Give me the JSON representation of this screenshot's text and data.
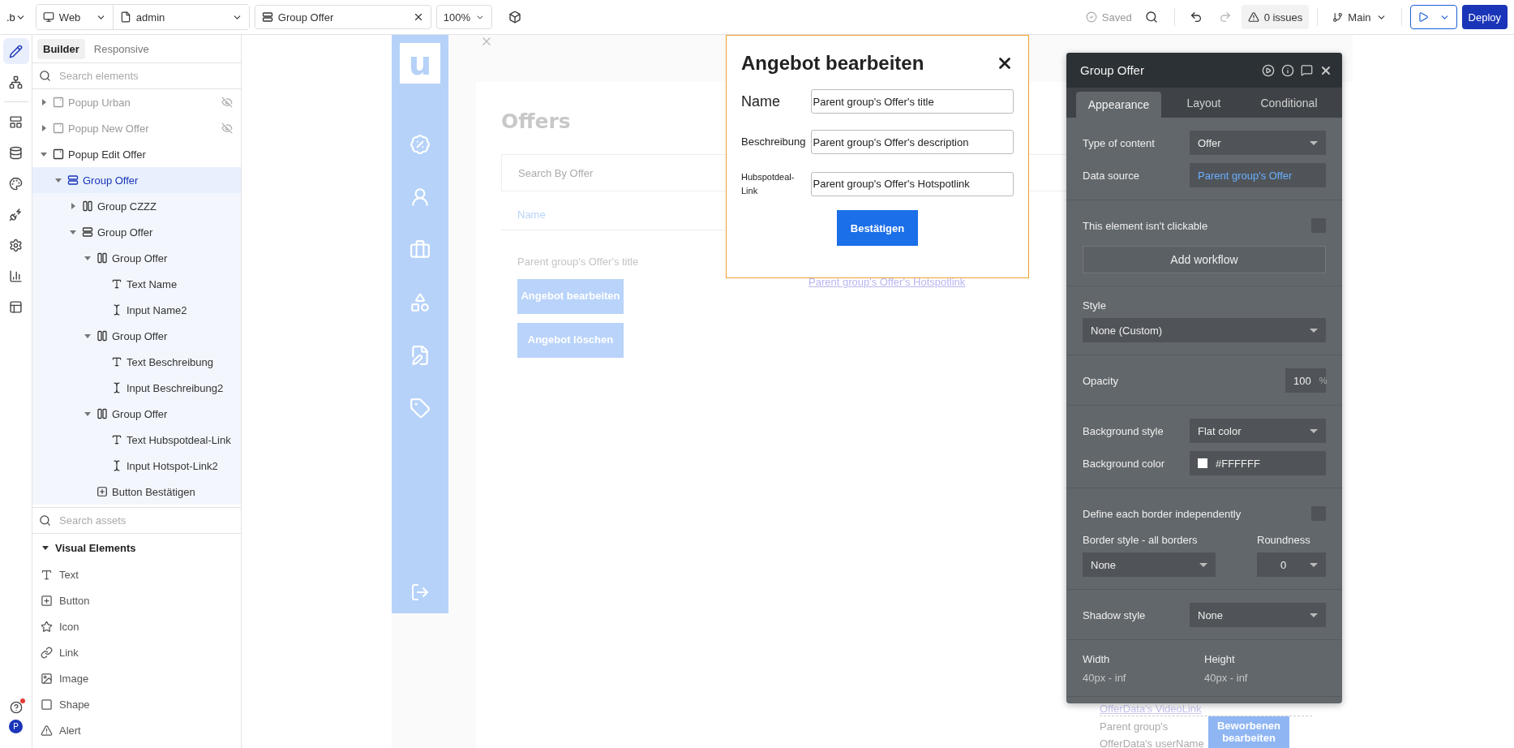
{
  "topbar": {
    "logo": ".b",
    "platform": "Web",
    "page": "admin",
    "element": "Group Offer",
    "zoom": "100%",
    "saved": "Saved",
    "issues": "0 issues",
    "branch": "Main",
    "deploy": "Deploy"
  },
  "rail": {
    "primary": [
      {
        "kind": "design",
        "selected": true
      },
      {
        "kind": "tree",
        "selected": false
      }
    ],
    "secondary": [
      {
        "kind": "styles",
        "selected": false
      },
      {
        "kind": "data",
        "selected": false
      },
      {
        "kind": "palette",
        "selected": false
      },
      {
        "kind": "plugins",
        "selected": false
      },
      {
        "kind": "settings",
        "selected": false
      },
      {
        "kind": "logs",
        "selected": false
      },
      {
        "kind": "templates",
        "selected": false
      }
    ],
    "help": {
      "notification": true
    },
    "avatar": "P"
  },
  "builder_tabs": [
    {
      "label": "Builder",
      "selected": true
    },
    {
      "label": "Responsive",
      "selected": false
    }
  ],
  "element_search": {
    "placeholder": "Search elements"
  },
  "tree": [
    {
      "label": "Popup Urban",
      "kind": "popup",
      "hidden": true,
      "expanded": false,
      "selected": false
    },
    {
      "label": "Popup New Offer",
      "kind": "popup",
      "hidden": true,
      "expanded": false,
      "selected": false
    },
    {
      "label": "Popup Edit Offer",
      "kind": "popup",
      "hidden": false,
      "expanded": true,
      "selected": false,
      "children": [
        {
          "label": "Group Offer",
          "kind": "rows",
          "hidden": false,
          "expanded": true,
          "selected": true,
          "children": [
            {
              "label": "Group CZZZ",
              "kind": "columns",
              "hidden": false,
              "expanded": false,
              "selected": false
            },
            {
              "label": "Group Offer",
              "kind": "rows",
              "hidden": false,
              "expanded": true,
              "selected": false,
              "children": [
                {
                  "label": "Group Offer",
                  "kind": "columns",
                  "hidden": false,
                  "expanded": true,
                  "selected": false,
                  "children": [
                    {
                      "label": "Text Name",
                      "kind": "text",
                      "hidden": false,
                      "selected": false
                    },
                    {
                      "label": "Input Name2",
                      "kind": "input",
                      "hidden": false,
                      "selected": false
                    }
                  ]
                },
                {
                  "label": "Group Offer",
                  "kind": "columns",
                  "hidden": false,
                  "expanded": true,
                  "selected": false,
                  "children": [
                    {
                      "label": "Text Beschreibung",
                      "kind": "text",
                      "hidden": false,
                      "selected": false
                    },
                    {
                      "label": "Input Beschreibung2",
                      "kind": "input",
                      "hidden": false,
                      "selected": false
                    }
                  ]
                },
                {
                  "label": "Group Offer",
                  "kind": "columns",
                  "hidden": false,
                  "expanded": true,
                  "selected": false,
                  "children": [
                    {
                      "label": "Text Hubspotdeal-Link",
                      "kind": "text",
                      "hidden": false,
                      "selected": false
                    },
                    {
                      "label": "Input Hotspot-Link2",
                      "kind": "input",
                      "hidden": false,
                      "selected": false
                    }
                  ]
                },
                {
                  "label": "Button Bestätigen",
                  "kind": "button",
                  "hidden": false,
                  "selected": false
                }
              ]
            }
          ]
        }
      ]
    }
  ],
  "asset_search": {
    "placeholder": "Search assets"
  },
  "assets": {
    "title": "Visual Elements",
    "expanded": true,
    "items": [
      {
        "label": "Text",
        "kind": "text"
      },
      {
        "label": "Button",
        "kind": "button"
      },
      {
        "label": "Icon",
        "kind": "icon"
      },
      {
        "label": "Link",
        "kind": "link"
      },
      {
        "label": "Image",
        "kind": "image"
      },
      {
        "label": "Shape",
        "kind": "shape"
      },
      {
        "label": "Alert",
        "kind": "alert"
      }
    ]
  },
  "canvas": {
    "logo": "u",
    "nav": [
      {
        "kind": "percent"
      },
      {
        "kind": "user"
      },
      {
        "kind": "briefcase"
      },
      {
        "kind": "shapes"
      },
      {
        "kind": "document"
      },
      {
        "kind": "tag"
      }
    ],
    "heading": "Offers",
    "search": {
      "placeholder": "Search By Offer"
    },
    "column": "Name",
    "row_title": "Parent group's Offer's title",
    "buttons": [
      "Angebot bearbeiten",
      "Angebot löschen"
    ],
    "link": "Parent group's Offer's Hotspotlink",
    "video_link": "OfferData's VideoLink",
    "user_name": [
      "Parent group's",
      "OfferData's userName"
    ],
    "applied_button": "Beworbenen bearbeiten"
  },
  "popup": {
    "title": "Angebot bearbeiten",
    "fields": [
      {
        "label": "Name",
        "value": "Parent group's Offer's title"
      },
      {
        "label": "Beschreibung",
        "value": "Parent group's Offer's description"
      },
      {
        "label": "Hubspotdeal-Link",
        "value": "Parent group's Offer's Hotspotlink"
      }
    ],
    "button": "Bestätigen"
  },
  "properties": {
    "title": "Group Offer",
    "tabs": [
      {
        "label": "Appearance",
        "selected": true
      },
      {
        "label": "Layout",
        "selected": false
      },
      {
        "label": "Conditional",
        "selected": false
      }
    ],
    "sections": [
      {
        "rows": [
          {
            "kind": "select",
            "label": "Type of content",
            "value": "Offer"
          },
          {
            "kind": "expression",
            "label": "Data source",
            "value": "Parent group's Offer"
          }
        ]
      },
      {
        "rows": [
          {
            "kind": "checkbox",
            "label": "This element isn't clickable",
            "checked": false
          },
          {
            "kind": "button",
            "label": "Add workflow"
          }
        ]
      },
      {
        "rows": [
          {
            "kind": "wide-select",
            "label": "Style",
            "value": "None (Custom)"
          }
        ]
      },
      {
        "rows": [
          {
            "kind": "number",
            "label": "Opacity",
            "value": "100",
            "unit": "%"
          }
        ]
      },
      {
        "rows": [
          {
            "kind": "select",
            "label": "Background style",
            "value": "Flat color"
          },
          {
            "kind": "color",
            "label": "Background color",
            "value": "#FFFFFF",
            "color": "#ffffff"
          }
        ]
      },
      {
        "rows": [
          {
            "kind": "checkbox",
            "label": "Define each border independently",
            "checked": false
          },
          {
            "kind": "pair-select",
            "items": [
              {
                "label": "Border style - all borders",
                "value": "None"
              },
              {
                "label": "Roundness",
                "value": "0"
              }
            ]
          }
        ]
      },
      {
        "rows": [
          {
            "kind": "select",
            "label": "Shadow style",
            "value": "None"
          }
        ]
      },
      {
        "rows": [
          {
            "kind": "dimensions",
            "items": [
              {
                "label": "Width",
                "value": "40px - inf"
              },
              {
                "label": "Height",
                "value": "40px - inf"
              }
            ]
          }
        ]
      }
    ]
  }
}
